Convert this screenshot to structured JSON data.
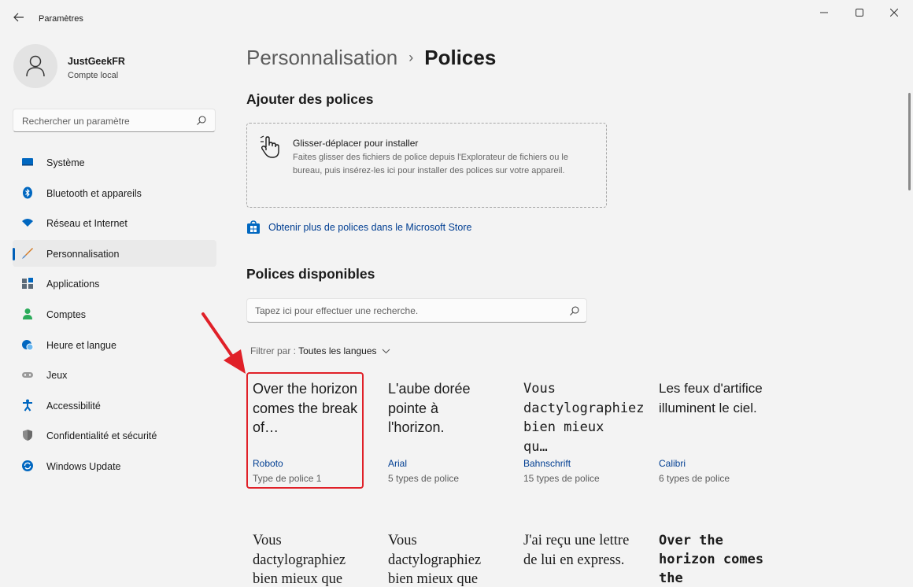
{
  "window": {
    "title": "Paramètres",
    "back_icon": "arrow-left-icon",
    "min_icon": "minimize-icon",
    "max_icon": "maximize-icon",
    "close_icon": "close-icon"
  },
  "profile": {
    "name": "JustGeekFR",
    "account_type": "Compte local"
  },
  "sidebar_search": {
    "placeholder": "Rechercher un paramètre"
  },
  "nav": [
    {
      "label": "Système",
      "icon": "monitor-icon",
      "color": "#0067c0"
    },
    {
      "label": "Bluetooth et appareils",
      "icon": "bluetooth-icon",
      "color": "#0067c0"
    },
    {
      "label": "Réseau et Internet",
      "icon": "wifi-icon",
      "color": "#0067c0"
    },
    {
      "label": "Personnalisation",
      "icon": "brush-icon",
      "color": "#d47a23",
      "active": true
    },
    {
      "label": "Applications",
      "icon": "apps-icon",
      "color": "#5b6a78"
    },
    {
      "label": "Comptes",
      "icon": "person-icon",
      "color": "#2bab5a"
    },
    {
      "label": "Heure et langue",
      "icon": "globe-clock-icon",
      "color": "#0067c0"
    },
    {
      "label": "Jeux",
      "icon": "gamepad-icon",
      "color": "#8a8a8a"
    },
    {
      "label": "Accessibilité",
      "icon": "accessibility-icon",
      "color": "#0067c0"
    },
    {
      "label": "Confidentialité et sécurité",
      "icon": "shield-icon",
      "color": "#707070"
    },
    {
      "label": "Windows Update",
      "icon": "update-icon",
      "color": "#0067c0"
    }
  ],
  "breadcrumb": {
    "parent": "Personnalisation",
    "separator": "›",
    "current": "Polices"
  },
  "add_fonts": {
    "heading": "Ajouter des polices",
    "drop_title": "Glisser-déplacer pour installer",
    "drop_desc": "Faites glisser des fichiers de police depuis l'Explorateur de fichiers ou le bureau, puis insérez-les ici pour installer des polices sur votre appareil.",
    "store_link": "Obtenir plus de polices dans le Microsoft Store"
  },
  "available": {
    "heading": "Polices disponibles",
    "search_placeholder": "Tapez ici pour effectuer une recherche.",
    "filter_label": "Filtrer par : ",
    "filter_value": "Toutes les langues"
  },
  "fonts": [
    {
      "preview": "Over the horizon comes the break of…",
      "name": "Roboto",
      "count": "Type de police 1",
      "highlighted": true
    },
    {
      "preview": "L'aube dorée pointe à l'horizon.",
      "name": "Arial",
      "count": "5 types de police"
    },
    {
      "preview": "Vous dactylographiez bien mieux qu…",
      "name": "Bahnschrift",
      "count": "15 types de police"
    },
    {
      "preview": "Les feux d'artifice illuminent le ciel.",
      "name": "Calibri",
      "count": "6 types de police"
    },
    {
      "preview": "Vous dactylographiez bien mieux que",
      "name": "",
      "count": ""
    },
    {
      "preview": "Vous dactylographiez bien mieux que",
      "name": "",
      "count": ""
    },
    {
      "preview": "J'ai reçu une lettre de lui en express.",
      "name": "",
      "count": ""
    },
    {
      "preview": "Over the horizon comes the",
      "name": "",
      "count": ""
    }
  ]
}
